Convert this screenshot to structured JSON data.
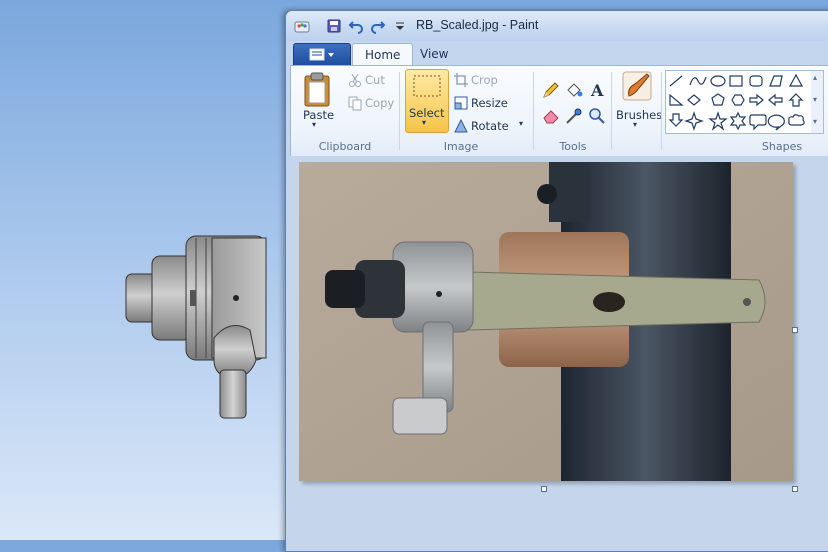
{
  "window": {
    "title": "RB_Scaled.jpg - Paint"
  },
  "quick_access": {
    "icons": [
      "paint-app-icon",
      "save-icon",
      "undo-icon",
      "redo-icon",
      "customize-dropdown-icon"
    ]
  },
  "tabs": [
    {
      "label": "Home",
      "active": true
    },
    {
      "label": "View",
      "active": false
    }
  ],
  "ribbon": {
    "clipboard": {
      "paste_label": "Paste",
      "cut_label": "Cut",
      "copy_label": "Copy",
      "group_label": "Clipboard"
    },
    "image": {
      "select_label": "Select",
      "crop_label": "Crop",
      "resize_label": "Resize",
      "rotate_label": "Rotate",
      "group_label": "Image"
    },
    "tools": {
      "group_label": "Tools",
      "items": [
        "pencil-icon",
        "fill-icon",
        "text-icon",
        "eraser-icon",
        "color-picker-icon",
        "magnifier-icon"
      ]
    },
    "brushes": {
      "label": "Brushes"
    },
    "shapes": {
      "group_label": "Shapes",
      "items": [
        "line",
        "curve",
        "oval",
        "rectangle",
        "rounded-rectangle",
        "polygon",
        "triangle",
        "right-triangle",
        "diamond",
        "pentagon",
        "hexagon",
        "right-arrow",
        "left-arrow",
        "up-arrow",
        "down-arrow",
        "four-point-star",
        "five-point-star",
        "six-point-star",
        "rounded-callout",
        "oval-callout",
        "cloud-callout"
      ]
    }
  },
  "colors": {
    "ribbon_bg": "#eef4fb",
    "select_active": "#f9d46c",
    "app_button": "#1f4f9f",
    "canvas_area": "#c5d6ec",
    "desktop_top": "#7aa7dd"
  }
}
